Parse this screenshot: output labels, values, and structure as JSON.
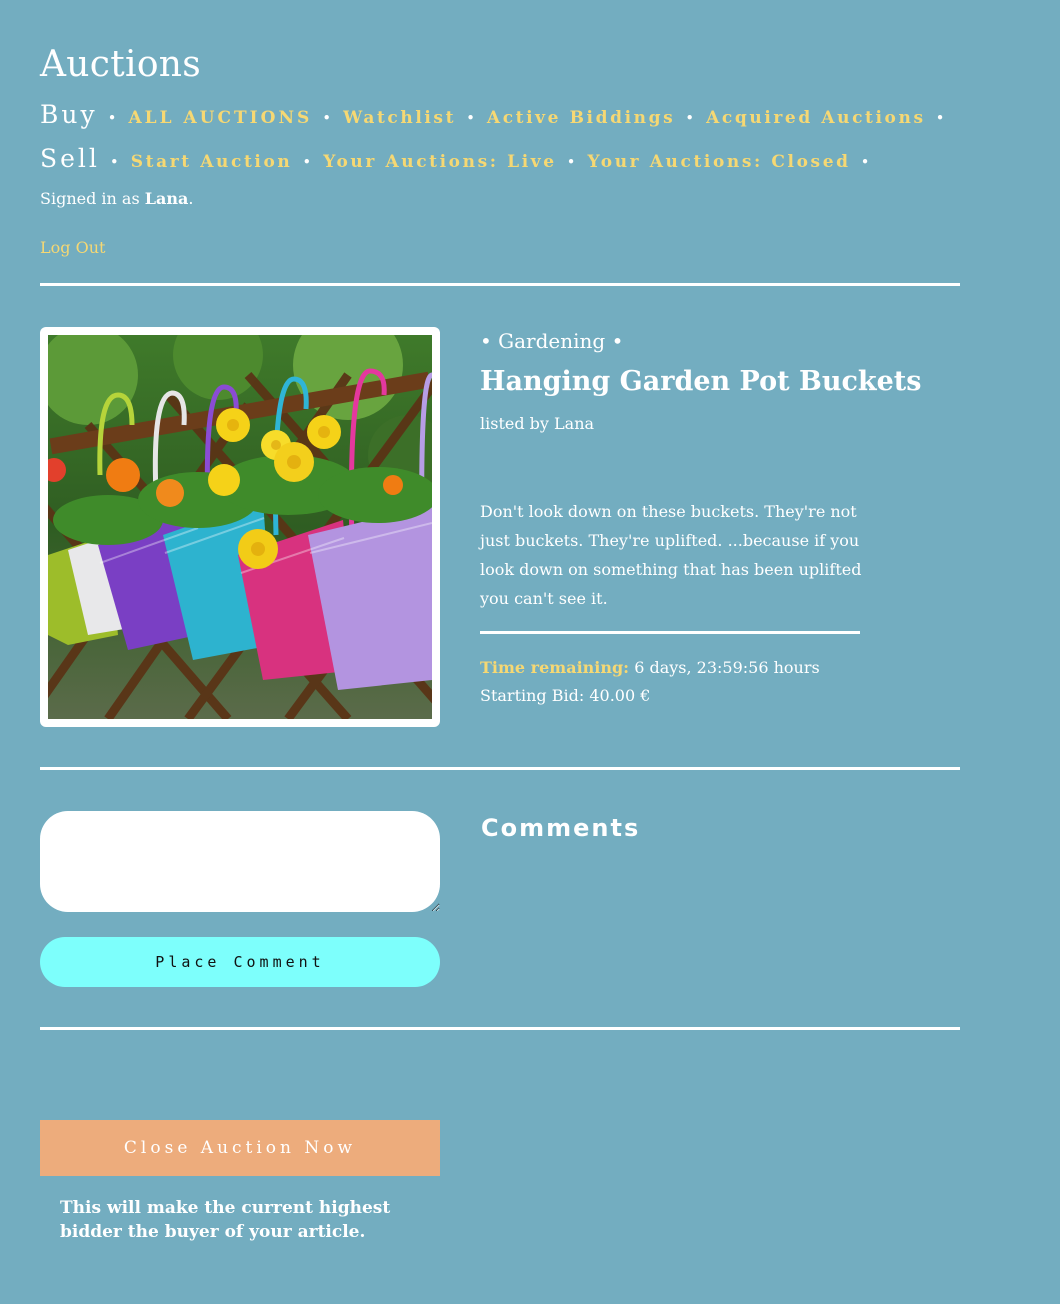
{
  "header": {
    "title": "Auctions",
    "buy_label": "Buy",
    "sell_label": "Sell",
    "buy_links": [
      "All Auctions",
      "Watchlist",
      "Active Biddings",
      "Acquired Auctions"
    ],
    "sell_links": [
      "Start Auction",
      "Your Auctions: Live",
      "Your Auctions: Closed"
    ],
    "separator": "•",
    "signed_in_prefix": "Signed in as",
    "signed_in_user": "Lana",
    "signed_in_suffix": ".",
    "logout_label": "Log Out"
  },
  "item": {
    "category": "• Gardening •",
    "title": "Hanging Garden Pot Buckets",
    "listed_by": "listed by Lana",
    "description": "Don't look down on these buckets. They're not just buckets. They're uplifted. ...because if you look down on something that has been uplifted you can't see it.",
    "time_label": "Time remaining:",
    "time_value": "6 days, 23:59:56 hours",
    "starting_bid": "Starting Bid: 40.00 €",
    "image_icon": "hanging-flower-buckets-photo"
  },
  "comments": {
    "heading": "Comments",
    "input_value": "",
    "place_button": "Place Comment"
  },
  "close": {
    "button": "Close Auction Now",
    "note": "This will make the current highest bidder the buyer of your article."
  },
  "colors": {
    "background": "#73adc0",
    "link": "#f6d873",
    "place_button": "#7dfffc",
    "close_button": "#edac7c"
  }
}
